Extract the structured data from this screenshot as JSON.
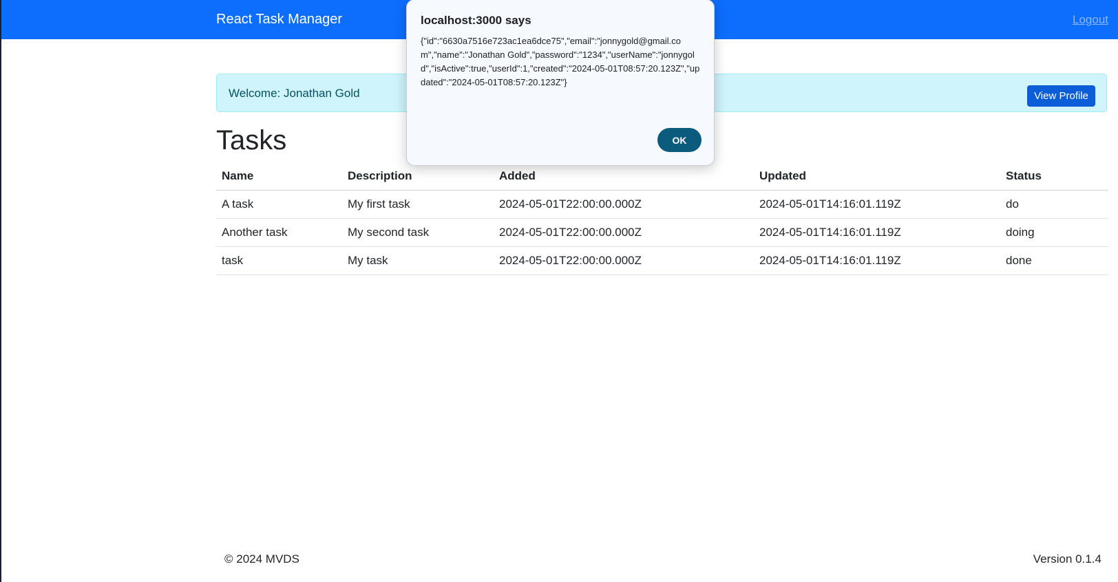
{
  "navbar": {
    "brand": "React Task Manager",
    "logout_label": "Logout"
  },
  "welcome": {
    "text": "Welcome: Jonathan Gold",
    "view_profile_label": "View Profile"
  },
  "page_title": "Tasks",
  "table": {
    "headers": [
      "Name",
      "Description",
      "Added",
      "Updated",
      "Status"
    ],
    "rows": [
      [
        "A task",
        "My first task",
        "2024-05-01T22:00:00.000Z",
        "2024-05-01T14:16:01.119Z",
        "do"
      ],
      [
        "Another task",
        "My second task",
        "2024-05-01T22:00:00.000Z",
        "2024-05-01T14:16:01.119Z",
        "doing"
      ],
      [
        "task",
        "My task",
        "2024-05-01T22:00:00.000Z",
        "2024-05-01T14:16:01.119Z",
        "done"
      ]
    ]
  },
  "footer": {
    "copyright": "© 2024 MVDS",
    "version": "Version 0.1.4"
  },
  "dialog": {
    "title": "localhost:3000 says",
    "message": "{\"id\":\"6630a7516e723ac1ea6dce75\",\"email\":\"jonnygold@gmail.com\",\"name\":\"Jonathan Gold\",\"password\":\"1234\",\"userName\":\"jonnygold\",\"isActive\":true,\"userId\":1,\"created\":\"2024-05-01T08:57:20.123Z\",\"updated\":\"2024-05-01T08:57:20.123Z\"}",
    "ok_label": "OK"
  },
  "colors": {
    "navbar": "#0d6efd",
    "alert_bg": "#cff4fc",
    "alert_text": "#055160",
    "primary_button": "#0b5ed7",
    "dialog_ok": "#0b5c7c"
  }
}
